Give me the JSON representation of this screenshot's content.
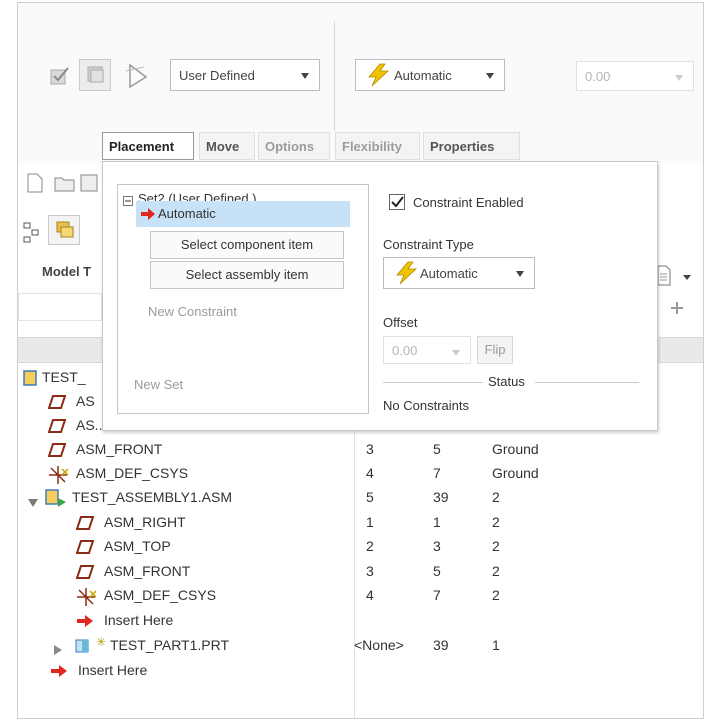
{
  "ribbon": {
    "placement_type": "User Defined",
    "constraint_type": "Automatic",
    "offset_value": "0.00"
  },
  "tabs": [
    {
      "label": "Placement"
    },
    {
      "label": "Move"
    },
    {
      "label": "Options"
    },
    {
      "label": "Flexibility"
    },
    {
      "label": "Properties"
    }
  ],
  "left_panel": {
    "model_tree_label": "Model T"
  },
  "placement_panel": {
    "set_label": "Set2 (User Defined )",
    "constraint_item": "Automatic",
    "select_component_item": "Select component item",
    "select_assembly_item": "Select assembly item",
    "new_constraint": "New Constraint",
    "new_set": "New Set",
    "constraint_enabled_label": "Constraint Enabled",
    "constraint_enabled": true,
    "constraint_type_label": "Constraint Type",
    "constraint_type_value": "Automatic",
    "offset_label": "Offset",
    "offset_value": "0.00",
    "flip_label": "Flip",
    "status_label": "Status",
    "status_value": "No Constraints"
  },
  "tree": {
    "rows": [
      {
        "name": "TEST_",
        "c1": "",
        "c2": "",
        "c3": ""
      },
      {
        "name": "AS",
        "c1": "",
        "c2": "",
        "c3": ""
      },
      {
        "name": "AS...",
        "c1": "",
        "c2": "",
        "c3": ""
      },
      {
        "name": "ASM_FRONT",
        "c1": "3",
        "c2": "5",
        "c3": "Ground"
      },
      {
        "name": "ASM_DEF_CSYS",
        "c1": "4",
        "c2": "7",
        "c3": "Ground"
      },
      {
        "name": "TEST_ASSEMBLY1.ASM",
        "c1": "5",
        "c2": "39",
        "c3": "2"
      },
      {
        "name": "ASM_RIGHT",
        "c1": "1",
        "c2": "1",
        "c3": "2"
      },
      {
        "name": "ASM_TOP",
        "c1": "2",
        "c2": "3",
        "c3": "2"
      },
      {
        "name": "ASM_FRONT",
        "c1": "3",
        "c2": "5",
        "c3": "2"
      },
      {
        "name": "ASM_DEF_CSYS",
        "c1": "4",
        "c2": "7",
        "c3": "2"
      },
      {
        "name": "Insert Here",
        "c1": "",
        "c2": "",
        "c3": ""
      },
      {
        "name": "TEST_PART1.PRT",
        "c1": "<None>",
        "c2": "39",
        "c3": "1"
      },
      {
        "name": "Insert Here",
        "c1": "",
        "c2": "",
        "c3": ""
      }
    ]
  },
  "colors": {
    "selection_bg": "#c7e1f6",
    "lightning": "#f0c400",
    "insert_arrow": "#e0271f",
    "datum_plane": "#8b2b14",
    "assembly_green": "#3aa64a"
  }
}
